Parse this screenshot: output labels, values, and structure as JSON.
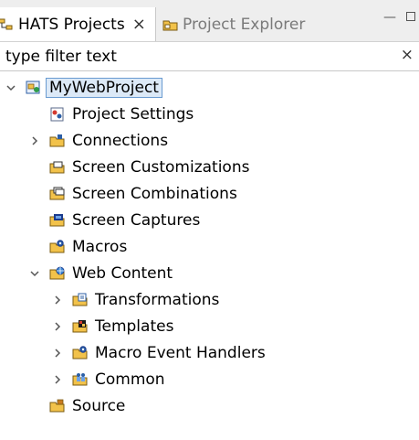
{
  "tabs": [
    {
      "label": "HATS Projects",
      "close": "×"
    },
    {
      "label": "Project Explorer"
    }
  ],
  "window_controls": {
    "minimize": "—"
  },
  "filter": {
    "placeholder": "type filter text",
    "clear": "×"
  },
  "tree": {
    "root": "MyWebProject",
    "items": [
      {
        "label": "Project Settings"
      },
      {
        "label": "Connections"
      },
      {
        "label": "Screen Customizations"
      },
      {
        "label": "Screen Combinations"
      },
      {
        "label": "Screen Captures"
      },
      {
        "label": "Macros"
      },
      {
        "label": "Web Content"
      },
      {
        "label": "Transformations"
      },
      {
        "label": "Templates"
      },
      {
        "label": "Macro Event Handlers"
      },
      {
        "label": "Common"
      },
      {
        "label": "Source"
      }
    ]
  },
  "colors": {
    "folder": "#f2c24a",
    "selection_bg": "#dce9f7",
    "selection_border": "#6a9bd1",
    "tab_bg": "#eeeeee"
  }
}
